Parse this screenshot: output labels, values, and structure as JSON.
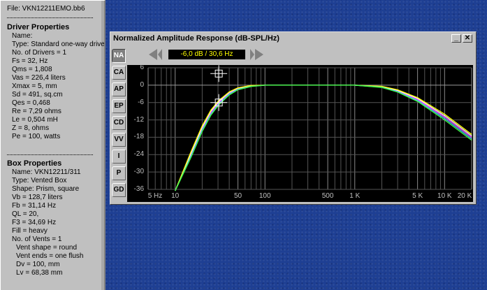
{
  "props": {
    "file": "File: VKN12211EMO.bb6",
    "driver_header": "Driver Properties",
    "driver_items": [
      "Name:",
      "Type: Standard one-way drive",
      "No. of Drivers = 1",
      "Fs = 32, Hz",
      "Qms = 1,808",
      "Vas = 226,4 liters",
      "Xmax = 5, mm",
      "Sd = 491, sq.cm",
      "Qes = 0,468",
      "Re = 7,29 ohms",
      "Le = 0,504 mH",
      "Z = 8, ohms",
      "Pe = 100, watts"
    ],
    "box_header": "Box Properties",
    "box_items": [
      "Name: VKN12211/311",
      "Type: Vented Box",
      "Shape: Prism, square",
      "Vb = 128,7 liters",
      "Fb = 31,14 Hz",
      "QL = 20,",
      "F3 = 34,69 Hz",
      "Fill = heavy",
      "No. of Vents = 1"
    ],
    "vent_items": [
      "Vent shape = round",
      "Vent ends = one flush",
      "Dv = 100, mm",
      "Lv = 68,38 mm"
    ]
  },
  "window": {
    "title": "Normalized Amplitude Response (dB-SPL/Hz)",
    "minimize": "_",
    "close": "✕",
    "readout": "-6,0 dB / 30,6 Hz",
    "tabs": [
      "NA",
      "CA",
      "AP",
      "EP",
      "CD",
      "VV",
      "I",
      "P",
      "GD"
    ],
    "active_tab": "NA"
  },
  "chart_data": {
    "type": "line",
    "title": "Normalized Amplitude Response (dB-SPL/Hz)",
    "x_scale": "log",
    "xlim": [
      5,
      20000
    ],
    "ylim": [
      -36,
      6
    ],
    "y_unit": "dB",
    "x_tick_labels": [
      {
        "value": 5,
        "label": "5 Hz"
      },
      {
        "value": 10,
        "label": "10"
      },
      {
        "value": 50,
        "label": "50"
      },
      {
        "value": 100,
        "label": "100"
      },
      {
        "value": 500,
        "label": "500"
      },
      {
        "value": 1000,
        "label": "1 K"
      },
      {
        "value": 5000,
        "label": "5 K"
      },
      {
        "value": 10000,
        "label": "10 K"
      },
      {
        "value": 20000,
        "label": "20 K"
      }
    ],
    "y_ticks": [
      6,
      0,
      -6,
      -12,
      -18,
      -24,
      -30,
      -36
    ],
    "grid": true,
    "cursor": {
      "x": 30.6,
      "y": -6.0
    },
    "series": [
      {
        "color": "#ff40ff",
        "x": [
          10,
          15,
          20,
          25,
          30.6,
          40,
          50,
          70,
          100,
          1000,
          2000,
          3000,
          5000,
          10000,
          20000
        ],
        "y": [
          -38,
          -24,
          -15,
          -9.5,
          -6,
          -2.8,
          -1.2,
          -0.3,
          0,
          0,
          -0.6,
          -2,
          -5,
          -11,
          -18
        ]
      },
      {
        "color": "#ffffff",
        "x": [
          10,
          15,
          20,
          25,
          30.6,
          40,
          50,
          70,
          100,
          1000,
          2000,
          3000,
          5000,
          10000,
          20000
        ],
        "y": [
          -37.5,
          -23.5,
          -14.5,
          -9,
          -5.6,
          -2.5,
          -1.0,
          -0.2,
          0,
          0,
          -0.5,
          -1.8,
          -4.6,
          -10.5,
          -17.5
        ]
      },
      {
        "color": "#ffff00",
        "x": [
          10,
          15,
          20,
          25,
          30.6,
          40,
          50,
          70,
          100,
          1000,
          2000,
          3000,
          5000,
          10000,
          20000
        ],
        "y": [
          -37,
          -23,
          -14,
          -8.6,
          -5.3,
          -2.3,
          -0.9,
          -0.1,
          0,
          0,
          -0.4,
          -1.6,
          -4.3,
          -10,
          -17
        ]
      },
      {
        "color": "#40c0ff",
        "x": [
          10,
          15,
          20,
          25,
          30.6,
          40,
          50,
          70,
          100,
          1000,
          2000,
          3000,
          5000,
          10000,
          20000
        ],
        "y": [
          -38.5,
          -24.5,
          -15.5,
          -10,
          -6.4,
          -3.1,
          -1.4,
          -0.4,
          0,
          0,
          -0.7,
          -2.2,
          -5.3,
          -11.5,
          -18.5
        ]
      },
      {
        "color": "#40ff40",
        "x": [
          10,
          15,
          20,
          25,
          30.6,
          40,
          50,
          70,
          100,
          1000,
          2000,
          3000,
          5000,
          10000,
          20000
        ],
        "y": [
          -39,
          -25,
          -16,
          -10.4,
          -6.8,
          -3.4,
          -1.6,
          -0.5,
          0,
          0,
          -0.8,
          -2.4,
          -5.6,
          -12,
          -19
        ]
      }
    ]
  }
}
